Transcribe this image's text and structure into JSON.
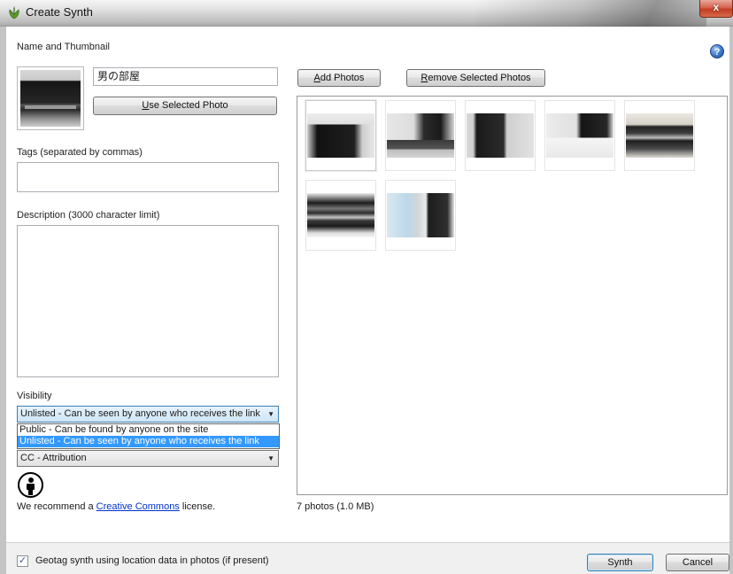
{
  "window": {
    "title": "Create Synth",
    "close_glyph": "x"
  },
  "left": {
    "name_section_label": "Name and Thumbnail",
    "name_value": "男の部屋",
    "use_selected_photo": {
      "underline": "U",
      "rest": "se Selected Photo"
    },
    "tags_label": "Tags (separated by commas)",
    "tags_value": "",
    "description_label": "Description (3000 character limit)",
    "description_value": "",
    "visibility_label": "Visibility",
    "visibility_selected": "Unlisted - Can be seen by anyone who receives the link",
    "visibility_options": [
      "Public - Can be found by anyone on the site",
      "Unlisted - Can be seen by anyone who receives the link"
    ],
    "license_selected": "CC - Attribution",
    "recommend_prefix": "We recommend a ",
    "recommend_link": "Creative Commons",
    "recommend_suffix": " license."
  },
  "right": {
    "add_photos": {
      "underline": "A",
      "rest": "dd Photos"
    },
    "remove_photos": {
      "underline": "R",
      "rest": "emove Selected Photos"
    },
    "photo_count": "7 photos (1.0 MB)",
    "help_glyph": "?"
  },
  "footer": {
    "geotag_checked": true,
    "checkmark": "✓",
    "geotag_label": "Geotag synth using location data in photos (if present)",
    "synth_label": "Synth",
    "cancel_label": "Cancel"
  },
  "icons": {
    "app": "synth-leaf-icon",
    "help": "help-icon",
    "license": "cc-attribution-icon"
  },
  "colors": {
    "dropdown_selection": "#3399ff",
    "link": "#0033cc",
    "close_button": "#c33c22"
  }
}
